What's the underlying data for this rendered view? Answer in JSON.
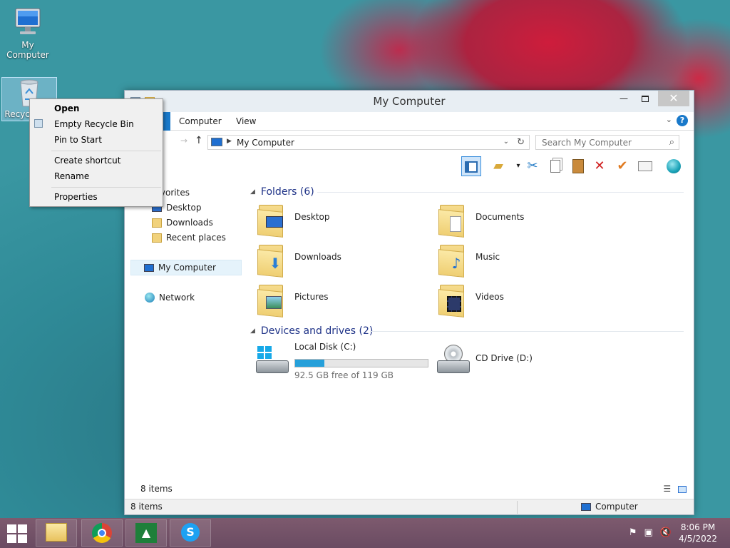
{
  "desktop": {
    "icons": [
      {
        "label": "My Computer",
        "icon": "computer-icon"
      },
      {
        "label": "Recycle Bin",
        "icon": "recycle-bin-icon"
      }
    ]
  },
  "window": {
    "title": "My Computer",
    "ribbon_tabs": [
      "Computer",
      "View"
    ],
    "address": {
      "crumb": "My Computer"
    },
    "search": {
      "placeholder": "Search My Computer"
    },
    "nav_pane": {
      "favorites": "Favorites",
      "items": [
        "Desktop",
        "Downloads",
        "Recent places"
      ],
      "my_computer": "My Computer",
      "network": "Network"
    },
    "folders": {
      "header": "Folders (6)",
      "items": [
        {
          "label": "Desktop",
          "icon": "folder-desktop-icon"
        },
        {
          "label": "Documents",
          "icon": "folder-documents-icon"
        },
        {
          "label": "Downloads",
          "icon": "folder-downloads-icon"
        },
        {
          "label": "Music",
          "icon": "folder-music-icon"
        },
        {
          "label": "Pictures",
          "icon": "folder-pictures-icon"
        },
        {
          "label": "Videos",
          "icon": "folder-videos-icon"
        }
      ]
    },
    "devices": {
      "header": "Devices and drives (2)",
      "local_disk": {
        "label": "Local Disk (C:)",
        "free_text": "92.5 GB free of 119 GB",
        "used_fraction": 0.223
      },
      "cd_drive": {
        "label": "CD Drive (D:)"
      }
    },
    "inner_status": "8 items",
    "status_bar": {
      "items": "8 items",
      "zone": "Computer"
    }
  },
  "context_menu": {
    "items": [
      "Open",
      "Empty Recycle Bin",
      "Pin to Start",
      "Create shortcut",
      "Rename",
      "Properties"
    ]
  },
  "taskbar": {
    "apps": [
      "file-explorer-icon",
      "chrome-icon",
      "stock-chart-icon",
      "skype-icon"
    ],
    "clock": {
      "time": "8:06 PM",
      "date": "4/5/2022"
    }
  },
  "colors": {
    "accent": "#1979ca",
    "selection": "#e5f3fb",
    "taskbar": "#6a4b62",
    "link_blue": "#1e3287"
  }
}
